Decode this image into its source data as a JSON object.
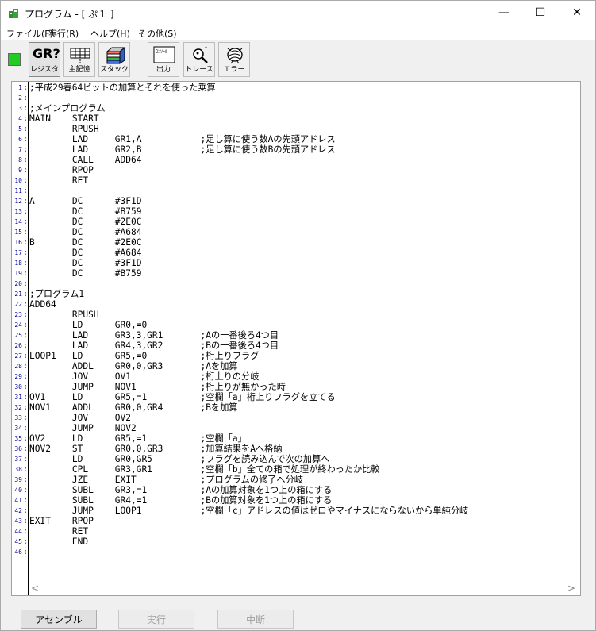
{
  "window": {
    "title": "プログラム - [ ぷ１ ]"
  },
  "controls": {
    "minimize": "—",
    "maximize": "☐",
    "close": "✕"
  },
  "menu": {
    "items": [
      {
        "label": "ファイル(F)"
      },
      {
        "label": "実行(R)"
      },
      {
        "label": "ヘルプ(H)"
      },
      {
        "label": "その他(S)"
      }
    ]
  },
  "toolbar": {
    "status_color": "#22cc22",
    "buttons": [
      {
        "label": "レジスタ",
        "icon": "gr-register-icon",
        "glyph": "GR?"
      },
      {
        "label": "主記憶",
        "icon": "memory-grid-icon"
      },
      {
        "label": "スタック",
        "icon": "stack-icon"
      },
      {
        "label": "出力",
        "icon": "console-icon",
        "glyph": "ｺﾝｿｰﾙ"
      },
      {
        "label": "トレース",
        "icon": "trace-magnifier-icon"
      },
      {
        "label": "エラー",
        "icon": "error-bug-icon"
      }
    ]
  },
  "editor": {
    "lines": [
      ";平成29春64ビットの加算とそれを使った乗算",
      "",
      ";メインプログラム",
      "MAIN    START",
      "        RPUSH",
      "        LAD     GR1,A           ;足し算に使う数Aの先頭アドレス",
      "        LAD     GR2,B           ;足し算に使う数Bの先頭アドレス",
      "        CALL    ADD64",
      "        RPOP",
      "        RET",
      "",
      "A       DC      #3F1D",
      "        DC      #B759",
      "        DC      #2E0C",
      "        DC      #A684",
      "B       DC      #2E0C",
      "        DC      #A684",
      "        DC      #3F1D",
      "        DC      #B759",
      "",
      ";プログラム1",
      "ADD64",
      "        RPUSH",
      "        LD      GR0,=0",
      "        LAD     GR3,3,GR1       ;Aの一番後ろ4つ目",
      "        LAD     GR4,3,GR2       ;Bの一番後ろ4つ目",
      "LOOP1   LD      GR5,=0          ;桁上りフラグ",
      "        ADDL    GR0,0,GR3       ;Aを加算",
      "        JOV     OV1             ;桁上りの分岐",
      "        JUMP    NOV1            ;桁上りが無かった時",
      "OV1     LD      GR5,=1          ;空欄「a」桁上りフラグを立てる",
      "NOV1    ADDL    GR0,0,GR4       ;Bを加算",
      "        JOV     OV2",
      "        JUMP    NOV2",
      "OV2     LD      GR5,=1          ;空欄「a」",
      "NOV2    ST      GR0,0,GR3       ;加算結果をAへ格納",
      "        LD      GR0,GR5         ;フラグを読み込んで次の加算へ",
      "        CPL     GR3,GR1         ;空欄「b」全ての箱で処理が終わったか比較",
      "        JZE     EXIT            ;プログラムの修了へ分岐",
      "        SUBL    GR3,=1          ;Aの加算対象を1つ上の箱にする",
      "        SUBL    GR4,=1          ;Bの加算対象を1つ上の箱にする",
      "        JUMP    LOOP1           ;空欄「c」アドレスの値はゼロやマイナスにならないから単純分岐",
      "EXIT    RPOP",
      "        RET",
      "        END",
      ""
    ],
    "scroll_left": "<",
    "scroll_right": ">"
  },
  "bottom_buttons": {
    "assemble": "アセンブル",
    "run": "実行",
    "stop": "中断"
  }
}
